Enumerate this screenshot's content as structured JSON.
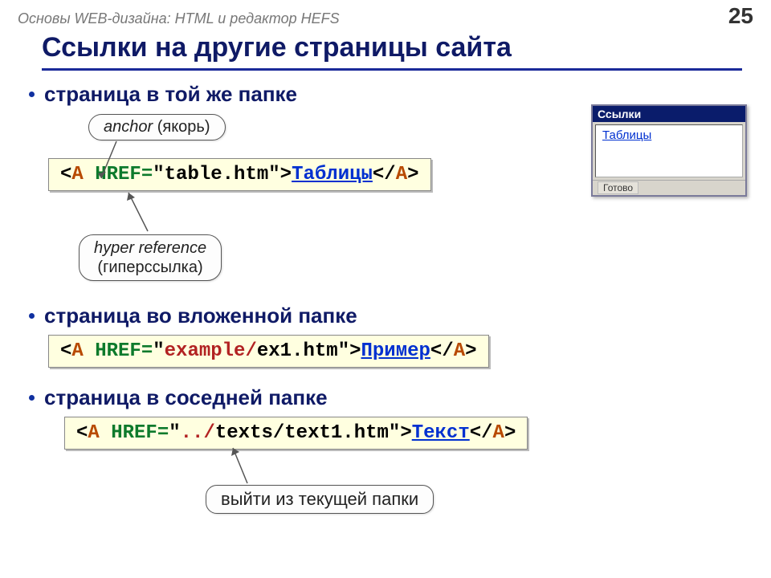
{
  "header": {
    "course": "Основы WEB-дизайна: HTML и редактор HEFS",
    "page": "25"
  },
  "title": "Ссылки на другие страницы сайта",
  "bullets": {
    "b1": "страница в той же папке",
    "b2": "страница во вложенной папке",
    "b3": "страница в соседней папке"
  },
  "callouts": {
    "anchor_main": "anchor",
    "anchor_par": " (якорь)",
    "hyper_main": "hyper reference",
    "hyper_par": "(гиперссылка)",
    "exit": "выйти из текущей папки"
  },
  "code1": {
    "lt1": "<",
    "a": "A",
    "sp": " ",
    "href": "HREF=",
    "q": "\"",
    "file": "table.htm",
    "gt": ">",
    "link": "Таблицы",
    "close1": "</",
    "close2": ">"
  },
  "code2": {
    "lt1": "<",
    "a": "A",
    "sp": " ",
    "href": "HREF=",
    "q": "\"",
    "dir": "example/",
    "file": "ex1.htm",
    "gt": ">",
    "link": "Пример",
    "close1": "</",
    "close2": ">"
  },
  "code3": {
    "lt1": "<",
    "a": "A",
    "sp": " ",
    "href": "HREF=",
    "q": "\"",
    "up": "../",
    "dir": "texts/text1.htm",
    "gt": ">",
    "link": "Текст",
    "close1": "</",
    "close2": ">"
  },
  "browser": {
    "title": "Ссылки",
    "link": "Таблицы",
    "status": "Готово"
  }
}
